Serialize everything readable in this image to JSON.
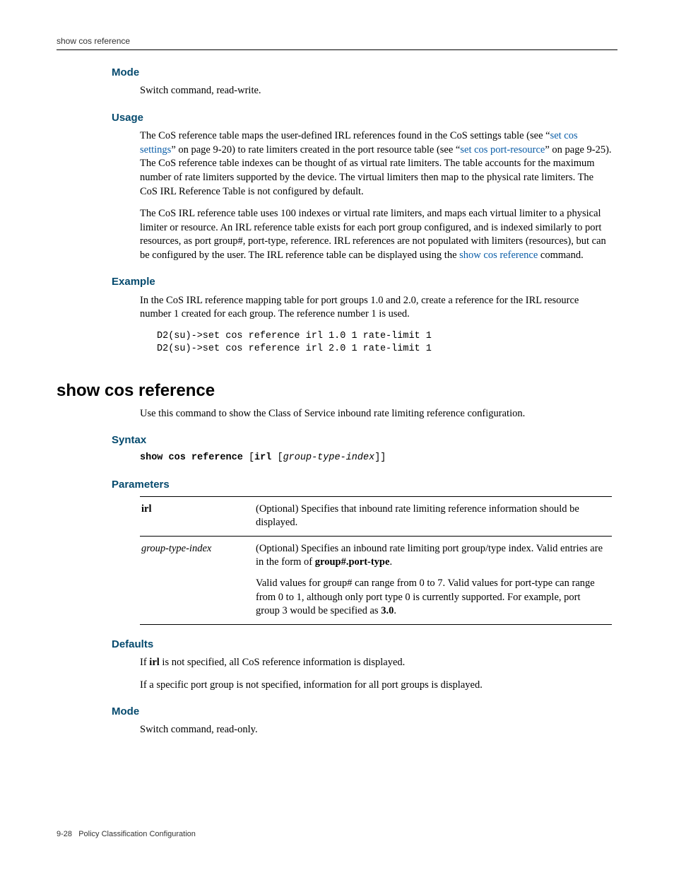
{
  "header": {
    "running_head": "show cos reference"
  },
  "sec1": {
    "mode": {
      "heading": "Mode",
      "text": "Switch command, read-write."
    },
    "usage": {
      "heading": "Usage",
      "p1a": "The CoS reference table maps the user-defined IRL references found in the CoS settings table (see “",
      "p1_link1": "set cos settings",
      "p1b": "” on page 9-20) to rate limiters created in the port resource table (see “",
      "p1_link2": "set cos port-resource",
      "p1c": "” on page 9-25). The CoS reference table indexes can be thought of as virtual rate limiters. The table accounts for the maximum number of rate limiters supported by the device. The virtual limiters then map to the physical rate limiters. The CoS IRL Reference Table is not configured by default.",
      "p2a": "The CoS IRL reference table uses 100 indexes or virtual rate limiters, and maps each virtual limiter to a physical limiter or resource. An IRL reference table exists for each port group configured, and is indexed similarly to port resources, as port group#, port-type, reference.   IRL references are not populated with limiters (resources), but can be configured by the user. The IRL reference table can be displayed using the ",
      "p2_link": "show cos reference",
      "p2b": " command."
    },
    "example": {
      "heading": "Example",
      "intro": "In the CoS IRL reference mapping table for port groups 1.0 and 2.0, create a reference for the IRL resource number 1 created for each group. The reference number 1 is used.",
      "code": "D2(su)->set cos reference irl 1.0 1 rate-limit 1\nD2(su)->set cos reference irl 2.0 1 rate-limit 1"
    }
  },
  "cmd": {
    "title": "show cos reference",
    "intro": "Use this command to show the Class of Service inbound rate limiting reference configuration.",
    "syntax": {
      "heading": "Syntax",
      "cmd_bold": "show cos reference ",
      "k1": "irl ",
      "arg": "group-type-index"
    },
    "parameters": {
      "heading": "Parameters",
      "rows": [
        {
          "name_bold": "irl",
          "desc": "(Optional) Specifies that inbound rate limiting reference information should be displayed."
        },
        {
          "name_ital": "group-type-index",
          "desc_a": "(Optional) Specifies an inbound rate limiting port group/type index. Valid entries are in the form of ",
          "desc_bold1": "group#.port-type",
          "desc_b": ".",
          "desc2_a": "Valid values for group# can range from 0 to 7. Valid values for port-type can range from 0 to 1, although only port type 0 is currently supported. For example, port group 3 would be specified as ",
          "desc2_bold": "3.0",
          "desc2_b": "."
        }
      ]
    },
    "defaults": {
      "heading": "Defaults",
      "p1a": "If ",
      "p1_bold": "irl",
      "p1b": " is not specified, all CoS reference information is displayed.",
      "p2": "If a specific port group is not specified, information for all port groups is displayed."
    },
    "mode": {
      "heading": "Mode",
      "text": "Switch command, read-only."
    }
  },
  "footer": {
    "page": "9-28",
    "chapter": "Policy Classification Configuration"
  }
}
